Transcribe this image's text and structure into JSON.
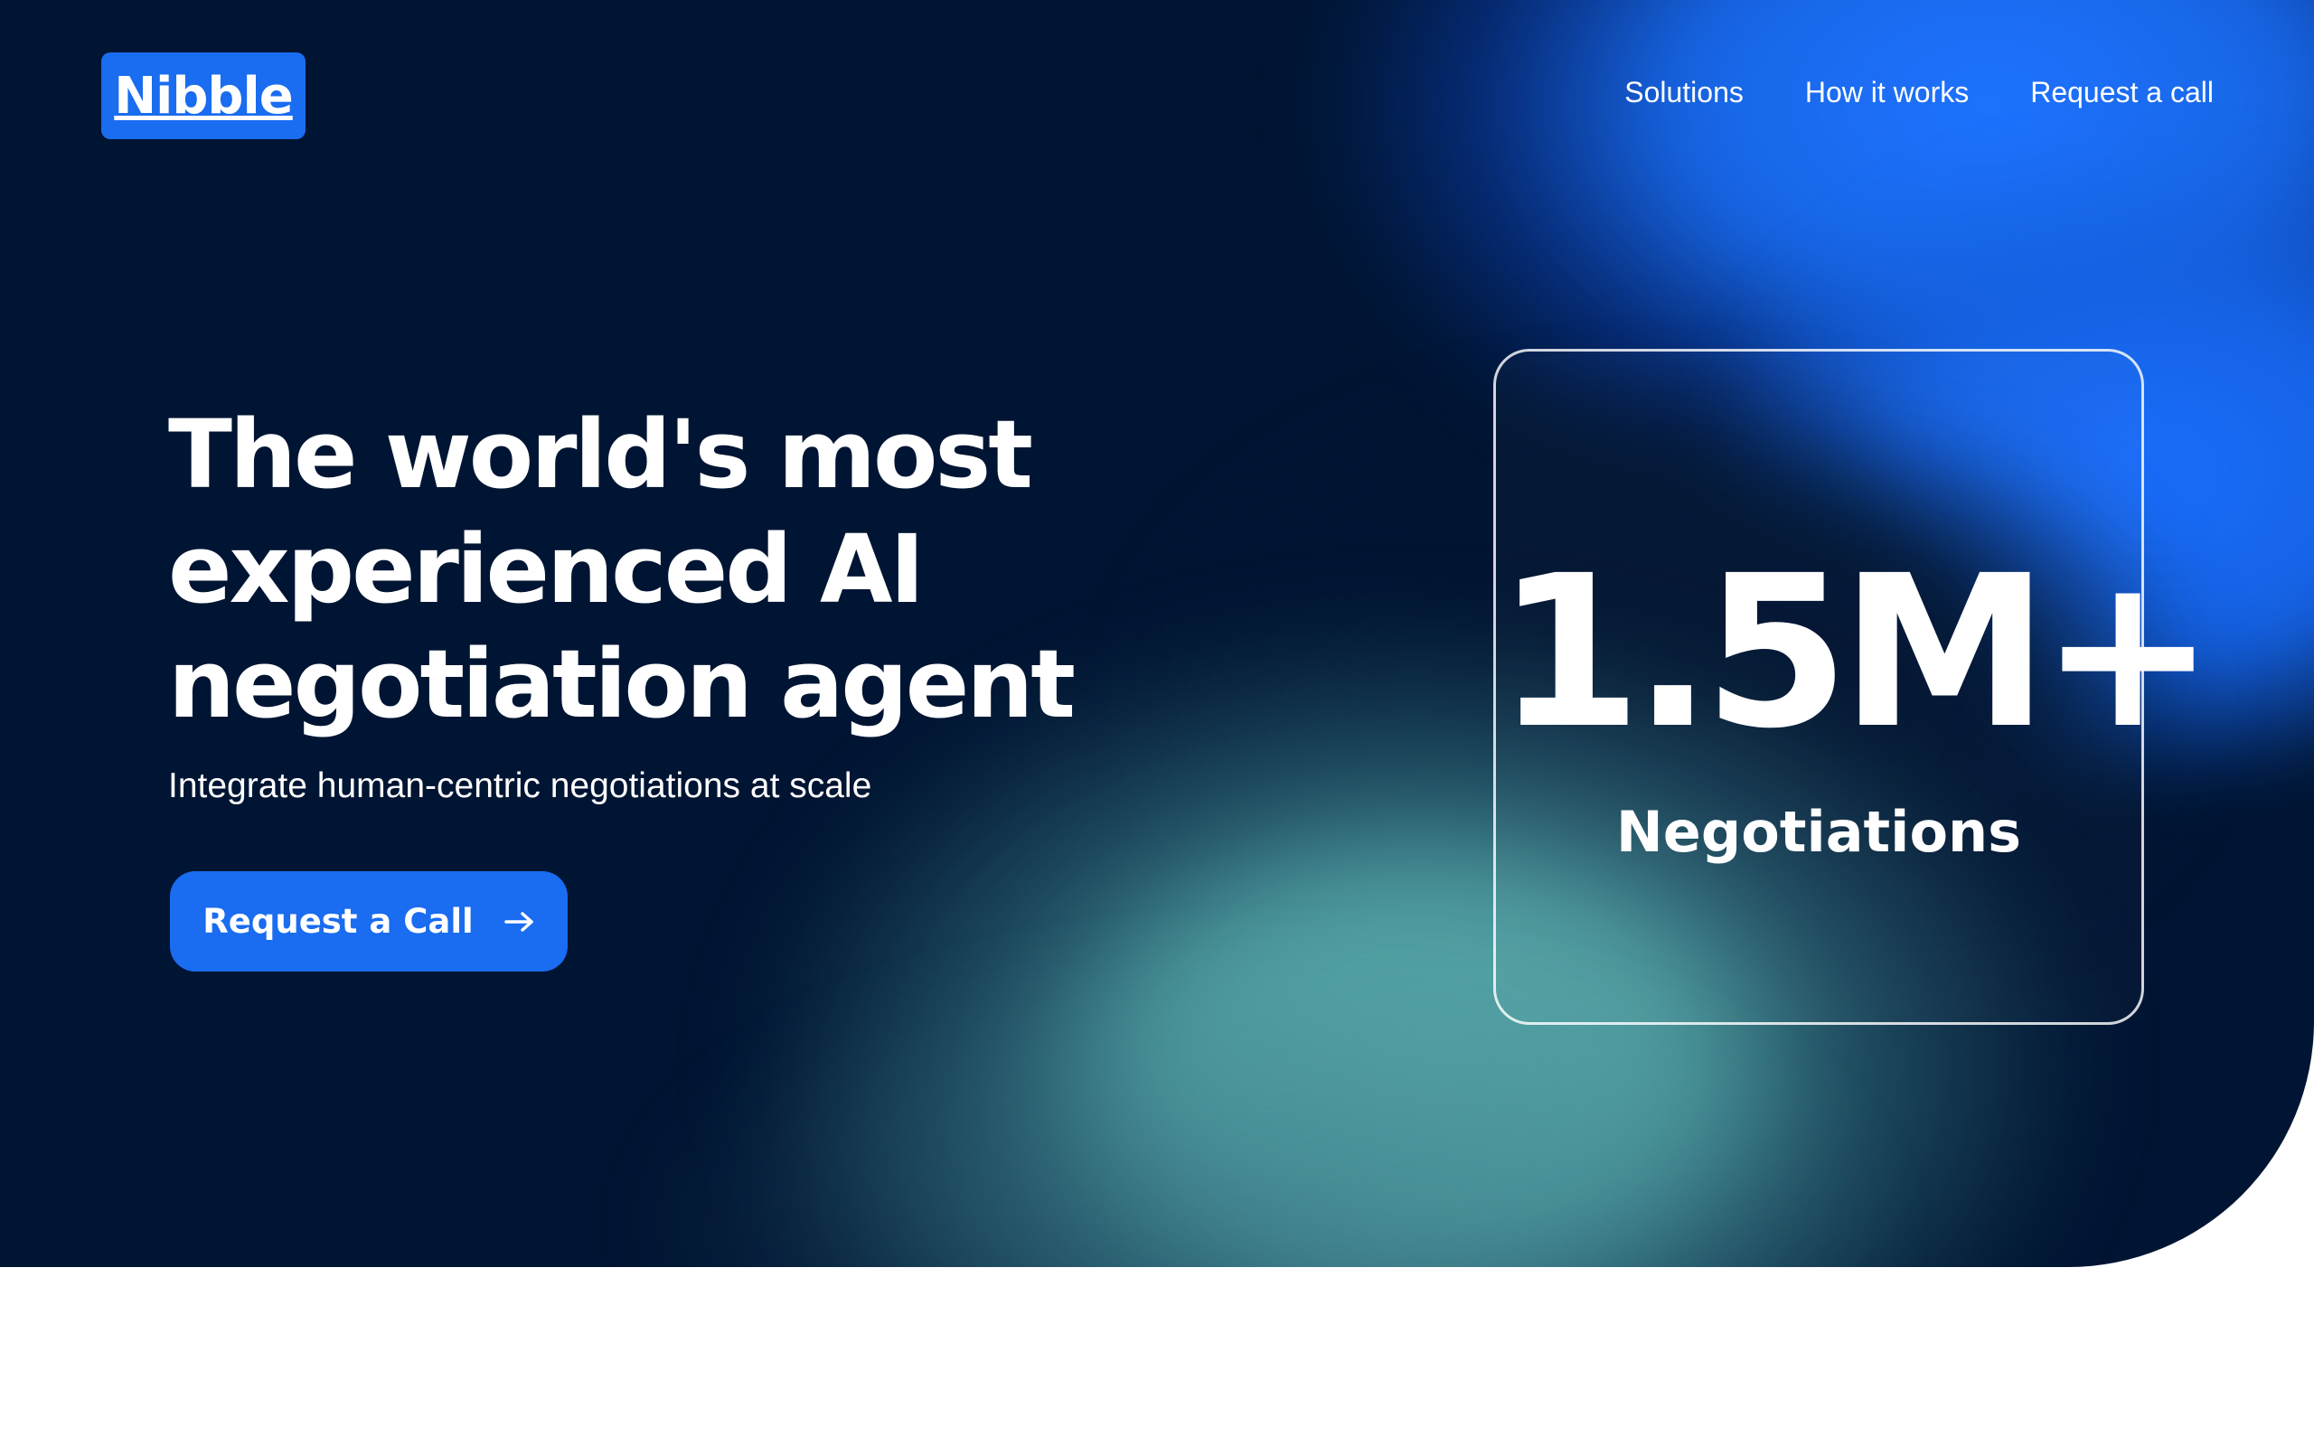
{
  "brand": {
    "logo_text": "Nibble",
    "accent_color": "#1a6cf0",
    "hero_background": "#001533"
  },
  "nav": {
    "items": [
      {
        "label": "Solutions"
      },
      {
        "label": "How it works"
      },
      {
        "label": "Request a call"
      }
    ]
  },
  "hero": {
    "headline_lines": [
      "The world's most",
      "experienced AI",
      "negotiation agent"
    ],
    "subtitle": "Integrate human-centric negotiations at scale",
    "cta_label": "Request a Call",
    "cta_icon": "arrow-right-icon"
  },
  "stat": {
    "value": "1.5M+",
    "label": "Negotiations"
  }
}
